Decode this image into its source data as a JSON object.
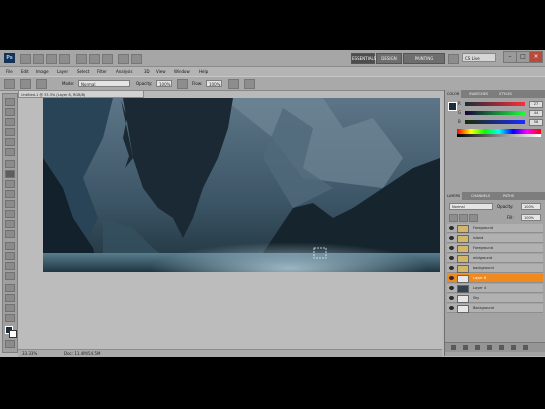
{
  "app": {
    "logo": "Ps",
    "workspaces": [
      "ESSENTIALS",
      "DESIGN",
      "PAINTING"
    ],
    "active_workspace": "ESSENTIALS",
    "search_placeholder": "CS Live",
    "window_controls": [
      "–",
      "□",
      "×"
    ]
  },
  "menu": [
    "File",
    "Edit",
    "Image",
    "Layer",
    "Select",
    "Filter",
    "Analysis",
    "3D",
    "View",
    "Window",
    "Help"
  ],
  "options": {
    "mode_label": "Mode:",
    "mode_value": "Normal",
    "opacity_label": "Opacity:",
    "opacity_value": "100%",
    "flow_label": "Flow:",
    "flow_value": "100%"
  },
  "document": {
    "tab_title": "Untitled-1 @ 33.3% (Layer 8, RGB/8)",
    "zoom": "33.33%",
    "doc_info": "Doc: 11.4M/54.5M"
  },
  "color_panel": {
    "tabs": [
      "COLOR",
      "SWATCHES",
      "STYLES"
    ],
    "channels": [
      {
        "label": "R",
        "value": "27"
      },
      {
        "label": "G",
        "value": "44"
      },
      {
        "label": "B",
        "value": "58"
      }
    ],
    "foreground": "#1b2c3a",
    "background": "#ffffff"
  },
  "layers_panel": {
    "tabs": [
      "LAYERS",
      "CHANNELS",
      "PATHS"
    ],
    "blend_mode": "Normal",
    "opacity_label": "Opacity:",
    "opacity_value": "100%",
    "fill_label": "Fill:",
    "fill_value": "100%",
    "layers": [
      {
        "name": "Foreground",
        "type": "folder",
        "selected": false
      },
      {
        "name": "island",
        "type": "folder",
        "selected": false
      },
      {
        "name": "Foreground",
        "type": "folder",
        "selected": false
      },
      {
        "name": "midground",
        "type": "folder",
        "selected": false
      },
      {
        "name": "background",
        "type": "folder",
        "selected": false
      },
      {
        "name": "Layer 8",
        "type": "layer",
        "selected": true
      },
      {
        "name": "Layer 4",
        "type": "dark",
        "selected": false
      },
      {
        "name": "Sky",
        "type": "layer",
        "selected": false
      },
      {
        "name": "Background",
        "type": "layer",
        "selected": false
      }
    ]
  },
  "colors": {
    "accent": "#f08a1e",
    "chrome": "#a6a6a6",
    "canvas_sky": "#4b6577",
    "canvas_water": "#2b4a5c"
  }
}
